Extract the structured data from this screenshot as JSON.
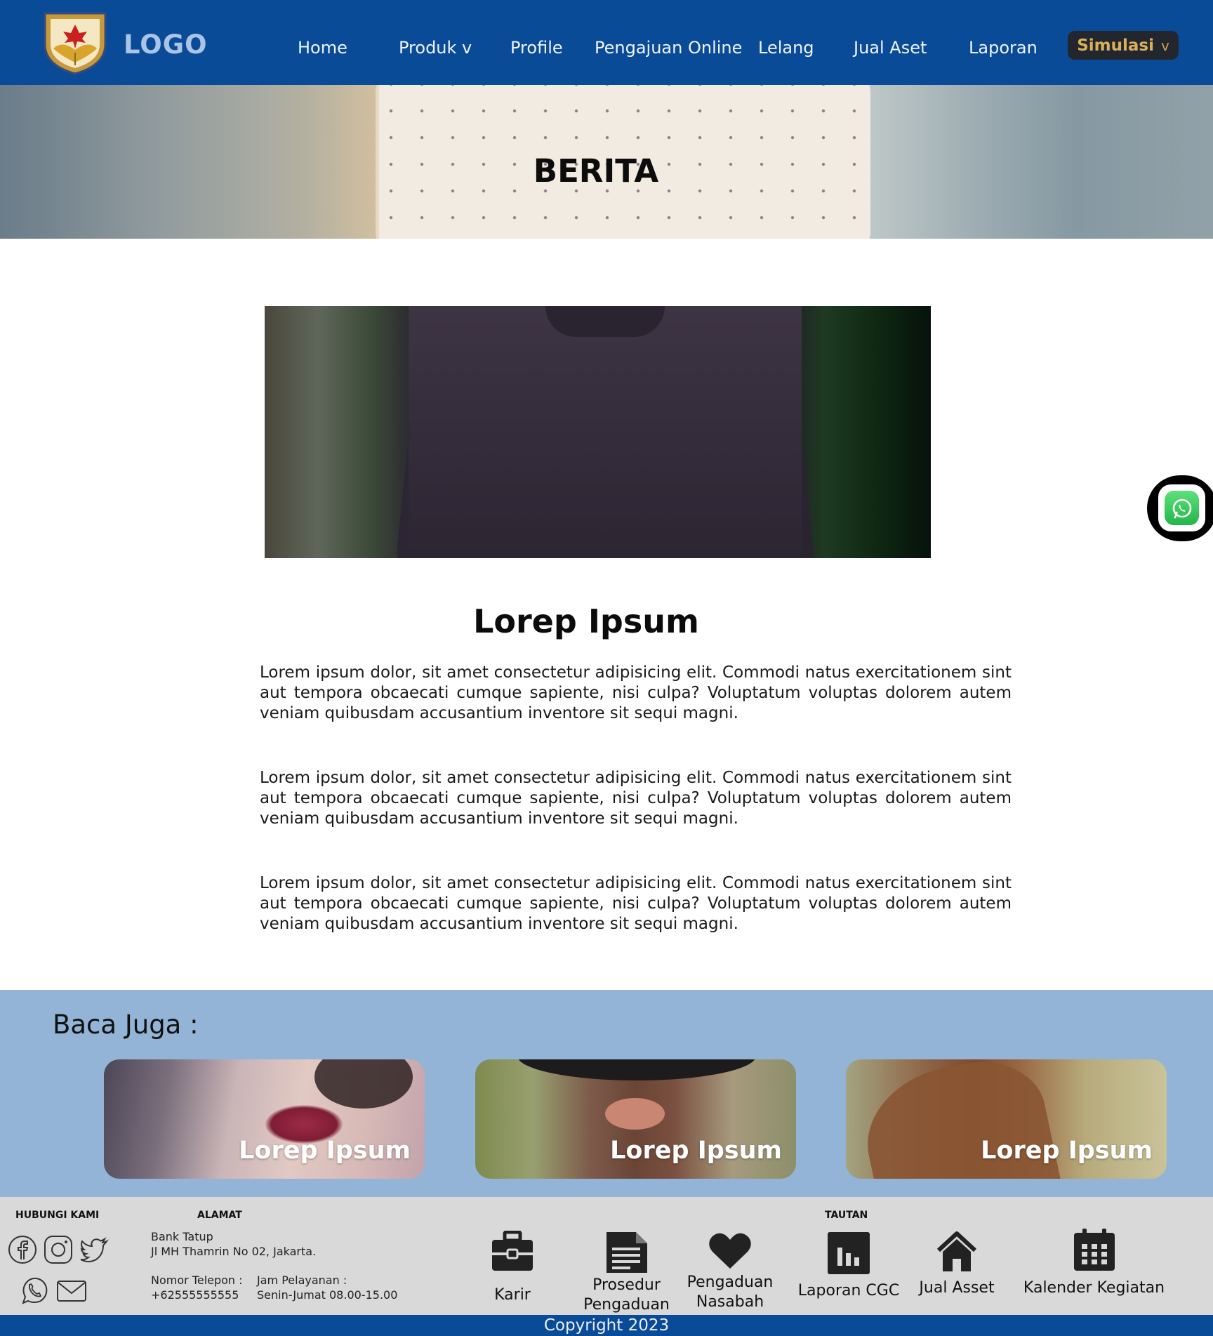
{
  "navbar": {
    "logo_text": "LOGO",
    "items": [
      {
        "label": "Home"
      },
      {
        "label": "Produk v"
      },
      {
        "label": "Profile"
      },
      {
        "label": "Pengajuan Online"
      },
      {
        "label": "Lelang"
      },
      {
        "label": "Jual Aset"
      },
      {
        "label": "Laporan"
      }
    ],
    "simulasi": {
      "label": "Simulasi",
      "chevron": "v"
    },
    "colors": {
      "bar": "#0a4b97",
      "simulasi_text": "#d9b15d"
    }
  },
  "hero": {
    "title": "BERITA"
  },
  "article": {
    "title": "Lorep Ipsum",
    "paragraphs": [
      "Lorem ipsum dolor, sit amet consectetur adipisicing elit. Commodi natus exercitationem sint aut tempora obcaecati cumque sapiente, nisi culpa? Voluptatum voluptas dolorem autem veniam quibusdam accusantium inventore sit sequi magni.",
      "Lorem ipsum dolor, sit amet consectetur adipisicing elit. Commodi natus exercitationem sint aut tempora obcaecati cumque sapiente, nisi culpa? Voluptatum voluptas dolorem autem veniam quibusdam accusantium inventore sit sequi magni.",
      "Lorem ipsum dolor, sit amet consectetur adipisicing elit. Commodi natus exercitationem sint aut tempora obcaecati cumque sapiente, nisi culpa? Voluptatum voluptas dolorem autem veniam quibusdam accusantium inventore sit sequi magni."
    ]
  },
  "floating": {
    "icon": "whatsapp-icon"
  },
  "related": {
    "heading": "Baca Juga :",
    "cards": [
      {
        "label": "Lorep Ipsum"
      },
      {
        "label": "Lorep Ipsum"
      },
      {
        "label": "Lorep Ipsum"
      }
    ],
    "colors": {
      "background": "#93b4d6"
    }
  },
  "footer": {
    "contact_heading": "HUBUNGI KAMI",
    "address_heading": "ALAMAT",
    "links_heading": "TAUTAN",
    "bank_name": "Bank Tatup",
    "address": "Jl MH Thamrin No 02, Jakarta.",
    "phone_label": "Nomor Telepon :",
    "phone_value": "+62555555555",
    "hours_label": "Jam Pelayanan :",
    "hours_value": "Senin-Jumat 08.00-15.00",
    "social_icons": [
      "facebook-icon",
      "instagram-icon",
      "twitter-icon",
      "whatsapp-icon",
      "mail-icon"
    ],
    "tiles": [
      {
        "label": "Karir",
        "icon": "briefcase-icon"
      },
      {
        "label_line1": "Prosedur",
        "label_line2": "Pengaduan",
        "icon": "document-icon"
      },
      {
        "label_line1": "Pengaduan",
        "label_line2": "Nasabah",
        "icon": "heart-icon"
      },
      {
        "label": "Laporan CGC",
        "icon": "bar-chart-icon"
      },
      {
        "label": "Jual Asset",
        "icon": "house-icon"
      },
      {
        "label": "Kalender Kegiatan",
        "icon": "calendar-icon"
      }
    ],
    "copyright": "Copyright 2023"
  }
}
